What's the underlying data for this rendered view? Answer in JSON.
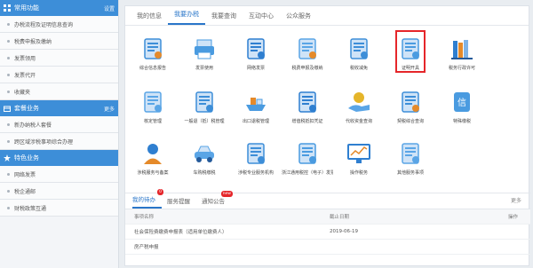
{
  "sidebar": {
    "sections": [
      {
        "title": "常用功能",
        "more": "设置",
        "items": [
          "办税流程及证明信息查询",
          "税费申报及缴纳",
          "发票领用",
          "发票代开",
          "收藏夹"
        ]
      },
      {
        "title": "套餐业务",
        "more": "更多",
        "items": [
          "新办纳税人套餐",
          "跨区域涉税事项综合办理"
        ]
      },
      {
        "title": "特色业务",
        "more": "",
        "items": [
          "网络发票",
          "税企通邮",
          "财税政策互通"
        ]
      }
    ]
  },
  "main": {
    "tabs": [
      "我的信息",
      "我要办税",
      "我要查询",
      "互动中心",
      "公众服务"
    ],
    "active_tab": 1,
    "tiles": [
      {
        "label": "综合信息报告",
        "icon": "clipboard-icon"
      },
      {
        "label": "发票使用",
        "icon": "printer-icon"
      },
      {
        "label": "网络发票",
        "icon": "invoice-network-icon"
      },
      {
        "label": "税费申报及缴纳",
        "icon": "declaration-icon"
      },
      {
        "label": "税收减免",
        "icon": "tax-reduction-icon"
      },
      {
        "label": "证明开具",
        "icon": "certificate-icon"
      },
      {
        "label": "税务行政许可",
        "icon": "books-icon"
      },
      {
        "label": "核定管理",
        "icon": "approval-icon"
      },
      {
        "label": "一般退（抵）税管理",
        "icon": "refund-icon"
      },
      {
        "label": "出口退税管理",
        "icon": "ship-icon"
      },
      {
        "label": "增值税抵扣凭证",
        "icon": "cabinet-icon"
      },
      {
        "label": "代收资金查询",
        "icon": "money-hand-icon"
      },
      {
        "label": "契税综合查询",
        "icon": "contract-search-icon"
      },
      {
        "label": "特殊缴税",
        "icon": "credit-icon"
      },
      {
        "label": "涉税服务与备案",
        "icon": "person-service-icon"
      },
      {
        "label": "车购税缴税",
        "icon": "car-icon"
      },
      {
        "label": "涉税专业服务机构",
        "icon": "handshake-icon"
      },
      {
        "label": "浙江通用税控（电子）发票管理",
        "icon": "tax-control-icon"
      },
      {
        "label": "操作税务",
        "icon": "monitor-chart-icon"
      },
      {
        "label": "其他服务事项",
        "icon": "other-services-icon"
      }
    ],
    "highlighted_tile": "证明开具"
  },
  "bottom": {
    "tabs": [
      {
        "label": "我的待办",
        "badge": "0"
      },
      {
        "label": "服务提醒",
        "badge": ""
      },
      {
        "label": "通知公告",
        "badge": "new"
      }
    ],
    "more": "更多",
    "columns": [
      "事项名称",
      "截止日期",
      "操作"
    ],
    "rows": [
      {
        "name": "社会保险费缴费申报表（适用单位缴费人）",
        "date": "2019-06-19",
        "action": ""
      },
      {
        "name": "房产税申报",
        "date": "",
        "action": ""
      }
    ]
  },
  "colors": {
    "brand": "#3d8ed8",
    "accent": "#2a76c9",
    "highlight": "#e5262a"
  }
}
